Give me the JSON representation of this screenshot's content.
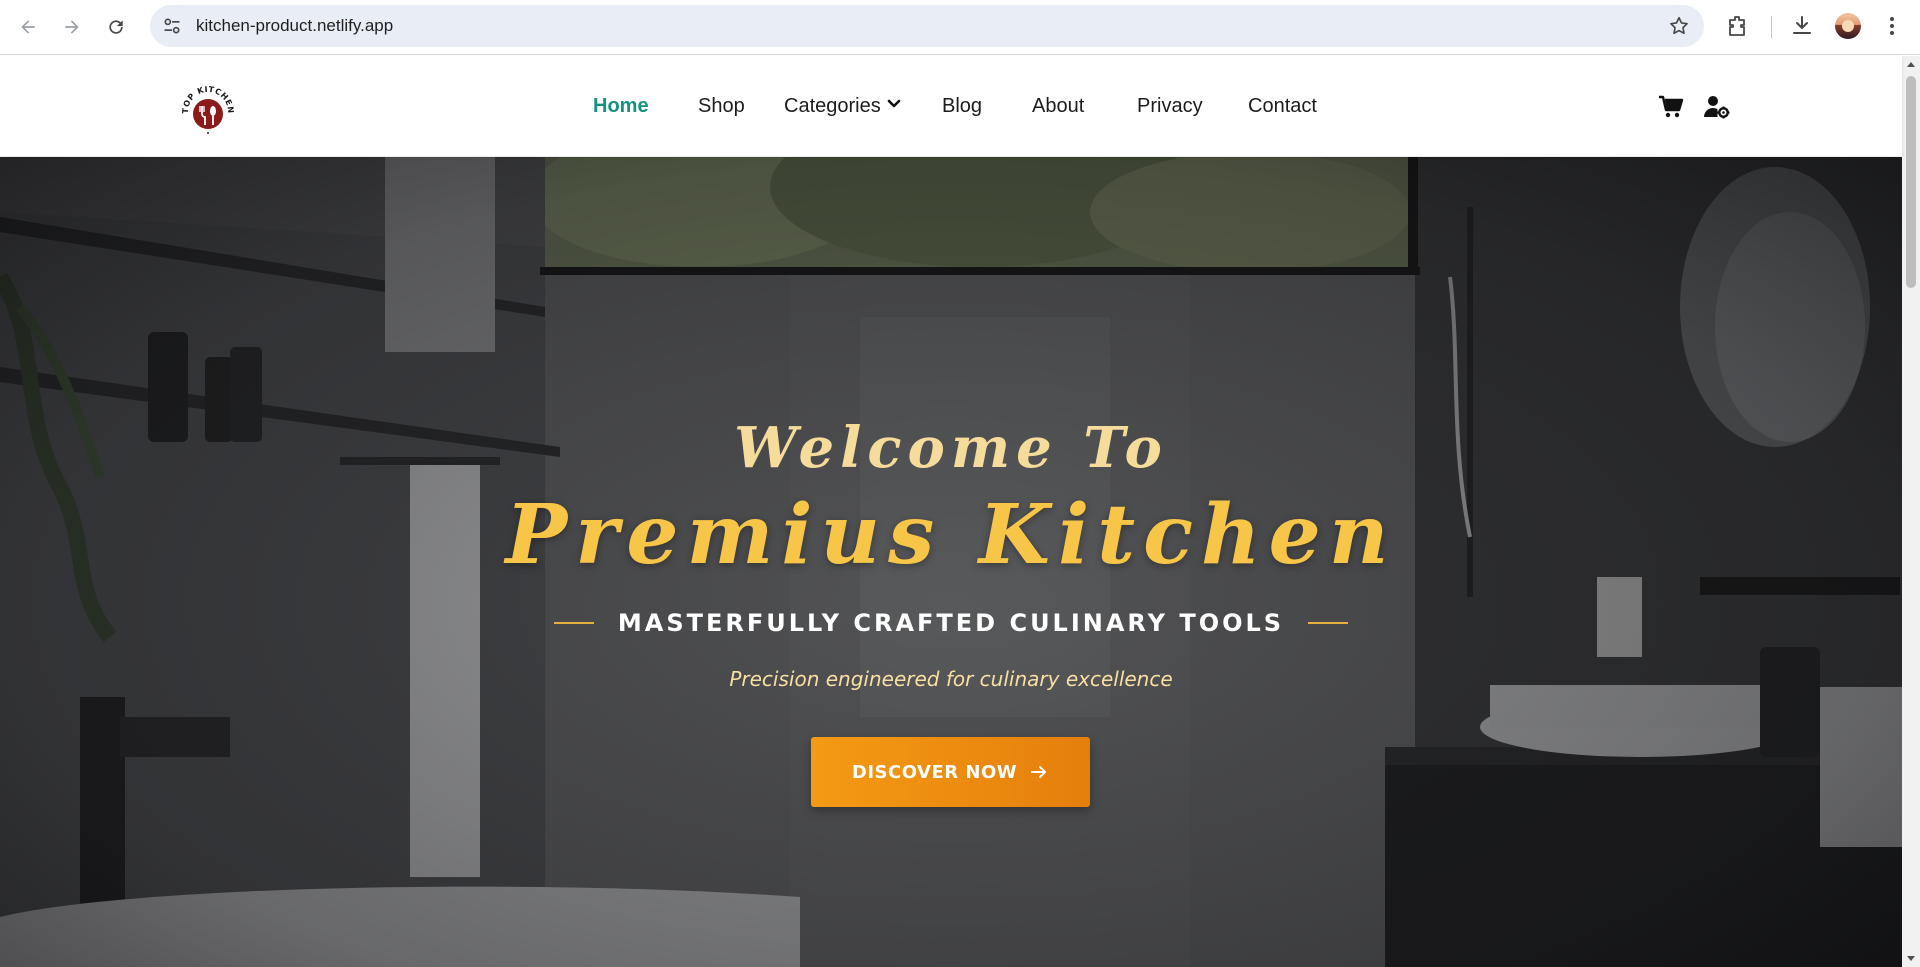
{
  "browser": {
    "url": "kitchen-product.netlify.app",
    "icons": [
      "back-arrow-icon",
      "forward-arrow-icon",
      "reload-icon",
      "site-settings-icon",
      "bookmark-star-icon",
      "extensions-icon",
      "download-icon",
      "profile-avatar",
      "kebab-menu-icon"
    ]
  },
  "header": {
    "logo_alt": "Top Kitchen",
    "menu": [
      {
        "label": "Home",
        "active": true
      },
      {
        "label": "Shop",
        "active": false
      },
      {
        "label": "Categories",
        "active": false,
        "dropdown": true
      },
      {
        "label": "Blog",
        "active": false
      },
      {
        "label": "About",
        "active": false
      },
      {
        "label": "Privacy",
        "active": false
      },
      {
        "label": "Contact",
        "active": false
      }
    ],
    "icons": [
      "cart-icon",
      "user-settings-icon"
    ],
    "active_color": "#17927e"
  },
  "hero": {
    "welcome": "Welcome To",
    "title": "Premius Kitchen",
    "subtitle": "MASTERFULLY CRAFTED CULINARY TOOLS",
    "tagline": "Precision engineered for culinary excellence",
    "cta_label": "DISCOVER NOW",
    "title_color": "#f7c548",
    "cta_color": "#f49a14"
  }
}
